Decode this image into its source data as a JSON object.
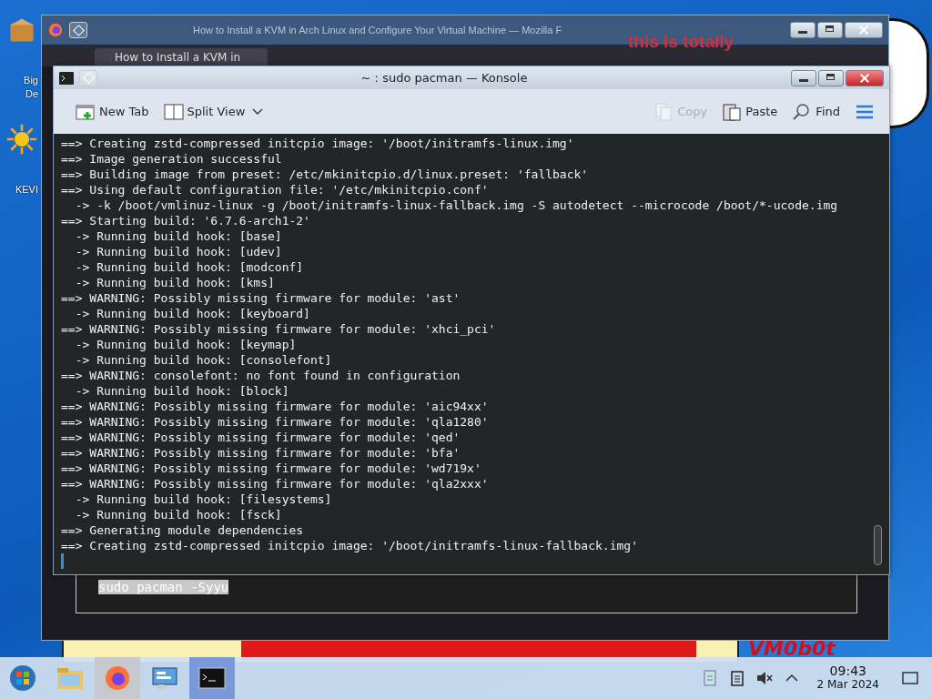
{
  "desktop_icons": [
    {
      "kind": "package",
      "lines": [
        "Big",
        "De"
      ]
    },
    {
      "kind": "sun",
      "lines": [
        "KEVI"
      ]
    }
  ],
  "wallpaper": {
    "banner_text": "this is totally",
    "signature": "VM0b0t"
  },
  "browser_window": {
    "title": "How to Install a KVM in Arch Linux and Configure Your Virtual Machine — Mozilla F",
    "tab": {
      "title": "How to Install a KVM in"
    },
    "code_block": "sudo pacman -Syyu"
  },
  "terminal_window": {
    "title": "~ : sudo pacman — Konsole",
    "toolbar": [
      {
        "kind": "new-tab",
        "label": "New Tab",
        "disabled": false
      },
      {
        "kind": "split-view",
        "label": "Split View",
        "disabled": false
      },
      {
        "kind": "copy",
        "label": "Copy",
        "disabled": true
      },
      {
        "kind": "paste",
        "label": "Paste",
        "disabled": false
      },
      {
        "kind": "find",
        "label": "Find",
        "disabled": false
      },
      {
        "kind": "menu",
        "disabled": false
      }
    ],
    "lines": [
      "==> Creating zstd-compressed initcpio image: '/boot/initramfs-linux.img'",
      "==> Image generation successful",
      "==> Building image from preset: /etc/mkinitcpio.d/linux.preset: 'fallback'",
      "==> Using default configuration file: '/etc/mkinitcpio.conf'",
      "  -> -k /boot/vmlinuz-linux -g /boot/initramfs-linux-fallback.img -S autodetect --microcode /boot/*-ucode.img",
      "==> Starting build: '6.7.6-arch1-2'",
      "  -> Running build hook: [base]",
      "  -> Running build hook: [udev]",
      "  -> Running build hook: [modconf]",
      "  -> Running build hook: [kms]",
      "==> WARNING: Possibly missing firmware for module: 'ast'",
      "  -> Running build hook: [keyboard]",
      "==> WARNING: Possibly missing firmware for module: 'xhci_pci'",
      "  -> Running build hook: [keymap]",
      "  -> Running build hook: [consolefont]",
      "==> WARNING: consolefont: no font found in configuration",
      "  -> Running build hook: [block]",
      "==> WARNING: Possibly missing firmware for module: 'aic94xx'",
      "==> WARNING: Possibly missing firmware for module: 'qla1280'",
      "==> WARNING: Possibly missing firmware for module: 'qed'",
      "==> WARNING: Possibly missing firmware for module: 'bfa'",
      "==> WARNING: Possibly missing firmware for module: 'wd719x'",
      "==> WARNING: Possibly missing firmware for module: 'qla2xxx'",
      "  -> Running build hook: [filesystems]",
      "  -> Running build hook: [fsck]",
      "==> Generating module dependencies",
      "==> Creating zstd-compressed initcpio image: '/boot/initramfs-linux-fallback.img'"
    ]
  },
  "taskbar": {
    "apps": [
      {
        "kind": "start",
        "selected": false,
        "open": false
      },
      {
        "kind": "files",
        "selected": false,
        "open": false
      },
      {
        "kind": "firefox",
        "selected": false,
        "open": true
      },
      {
        "kind": "control-panel",
        "selected": false,
        "open": false
      },
      {
        "kind": "terminal",
        "selected": true,
        "open": true
      }
    ],
    "volume": {
      "muted": true
    },
    "clock": {
      "time": "09:43",
      "date": "2 Mar 2024"
    }
  }
}
